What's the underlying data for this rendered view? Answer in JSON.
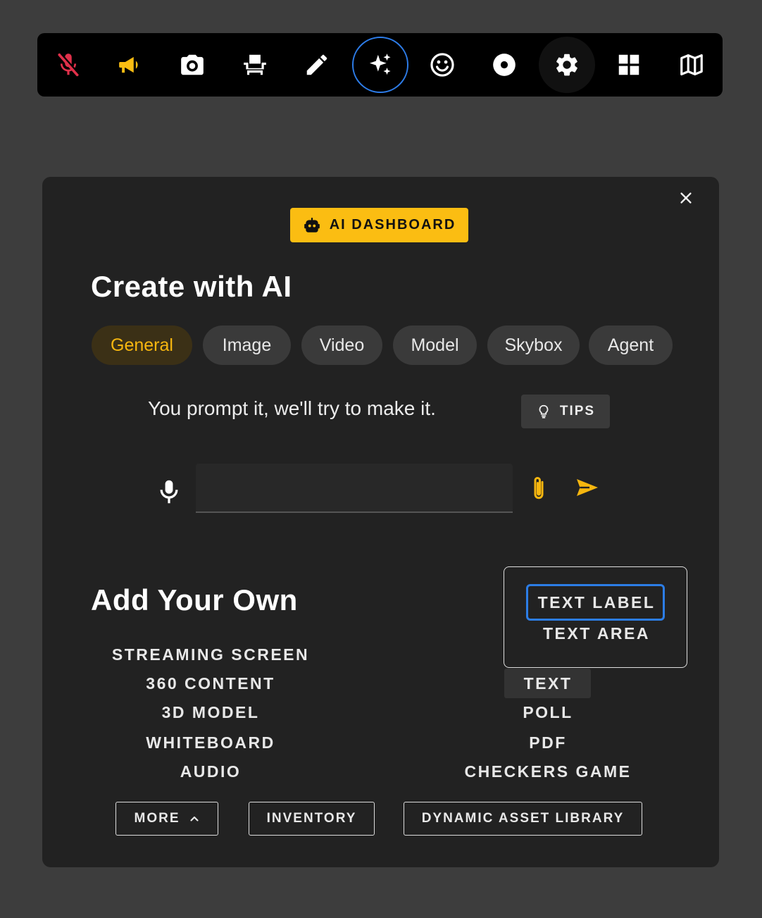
{
  "toolbar": {
    "buttons": [
      {
        "name": "muted-mic-icon",
        "color": "#e0304a"
      },
      {
        "name": "megaphone-icon",
        "color": "#fbbd12"
      },
      {
        "name": "camera-icon",
        "color": "#ffffff"
      },
      {
        "name": "seat-icon",
        "color": "#ffffff"
      },
      {
        "name": "pencil-icon",
        "color": "#ffffff"
      },
      {
        "name": "ai-sparkles-icon",
        "color": "#ffffff",
        "active": true
      },
      {
        "name": "smiley-icon",
        "color": "#ffffff"
      },
      {
        "name": "record-icon",
        "color": "#ffffff"
      },
      {
        "name": "gear-icon",
        "color": "#ffffff"
      },
      {
        "name": "grid-icon",
        "color": "#ffffff"
      },
      {
        "name": "map-icon",
        "color": "#ffffff"
      }
    ],
    "active_ring_color": "#2d7ce8"
  },
  "panel": {
    "badge_label": "AI DASHBOARD",
    "badge_color": "#fbbd12",
    "create_title": "Create with AI",
    "tabs": [
      "General",
      "Image",
      "Video",
      "Model",
      "Skybox",
      "Agent"
    ],
    "active_tab": "General",
    "accent_color": "#f6b60f",
    "prompt_hint": "You prompt it, we'll try to make it.",
    "tips_label": "TIPS",
    "prompt_value": "",
    "add_own_title": "Add Your Own",
    "left_items": [
      "STREAMING SCREEN",
      "360 CONTENT",
      "3D MODEL",
      "WHITEBOARD",
      "AUDIO"
    ],
    "text_options": [
      "TEXT LABEL",
      "TEXT AREA"
    ],
    "right_items": [
      "TEXT",
      "POLL",
      "PDF",
      "CHECKERS GAME"
    ],
    "buttons": {
      "more": "MORE",
      "inventory": "INVENTORY",
      "dynamic_library": "DYNAMIC ASSET LIBRARY"
    }
  }
}
